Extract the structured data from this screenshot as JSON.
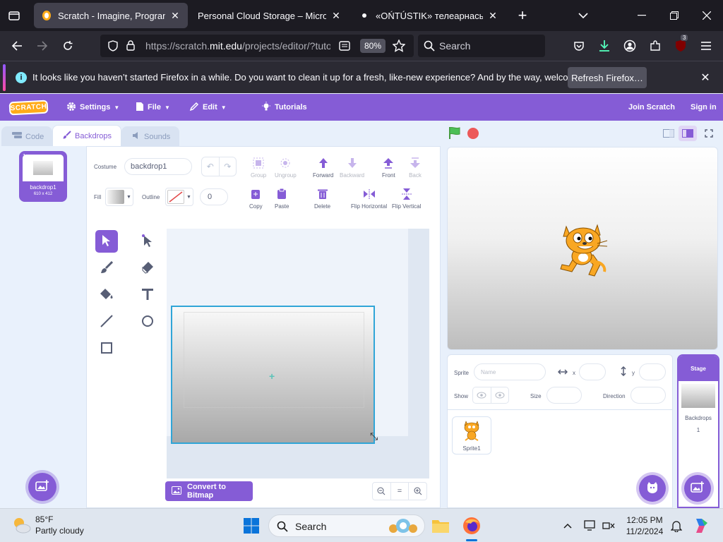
{
  "browser": {
    "tabs": [
      {
        "title": "Scratch - Imagine, Program, Sh",
        "active": true
      },
      {
        "title": "Personal Cloud Storage – Microsoft",
        "active": false
      },
      {
        "title": "«OŃTÚSTIK» телеарнасының р",
        "active": false
      }
    ],
    "url_prefix": "https://scratch.",
    "url_host": "mit.edu",
    "url_rest": "/projects/editor/?tuto",
    "zoom": "80%",
    "search_placeholder": "Search",
    "extensions_badge": "3"
  },
  "notification": {
    "text": "It looks like you haven’t started Firefox in a while. Do you want to clean it up for a fresh, like-new experience? And by the way, welcome back!",
    "button": "Refresh Firefox…"
  },
  "menubar": {
    "logo": "SCRATCH",
    "settings": "Settings",
    "file": "File",
    "edit": "Edit",
    "tutorials": "Tutorials",
    "join": "Join Scratch",
    "signin": "Sign in"
  },
  "editor_tabs": {
    "code": "Code",
    "backdrops": "Backdrops",
    "sounds": "Sounds"
  },
  "costumes": [
    {
      "number": "1",
      "name": "backdrop1",
      "size": "610 x 412"
    }
  ],
  "paint": {
    "costume_label": "Costume",
    "costume_name": "backdrop1",
    "group": "Group",
    "ungroup": "Ungroup",
    "forward": "Forward",
    "backward": "Backward",
    "front": "Front",
    "back": "Back",
    "fill_label": "Fill",
    "outline_label": "Outline",
    "outline_width": "0",
    "copy": "Copy",
    "paste": "Paste",
    "delete": "Delete",
    "flip_horizontal": "Flip Horizontal",
    "flip_vertical": "Flip Vertical",
    "convert_button": "Convert to Bitmap",
    "zoom_reset": "="
  },
  "sprite_info": {
    "sprite_label": "Sprite",
    "name_placeholder": "Name",
    "x_label": "x",
    "y_label": "y",
    "show_label": "Show",
    "size_label": "Size",
    "direction_label": "Direction"
  },
  "sprites": [
    {
      "name": "Sprite1"
    }
  ],
  "stage_target": {
    "header": "Stage",
    "backdrops_label": "Backdrops",
    "backdrops_count": "1"
  },
  "taskbar": {
    "temperature": "85°F",
    "condition": "Partly cloudy",
    "search": "Search",
    "time": "12:05 PM",
    "date": "11/2/2024"
  },
  "colors": {
    "scratch_purple": "#855cd6",
    "firefox_dark": "#1c1b22",
    "selection_blue": "#30a5d7",
    "stop_red": "#ec5959",
    "flag_green": "#4cbf56"
  }
}
